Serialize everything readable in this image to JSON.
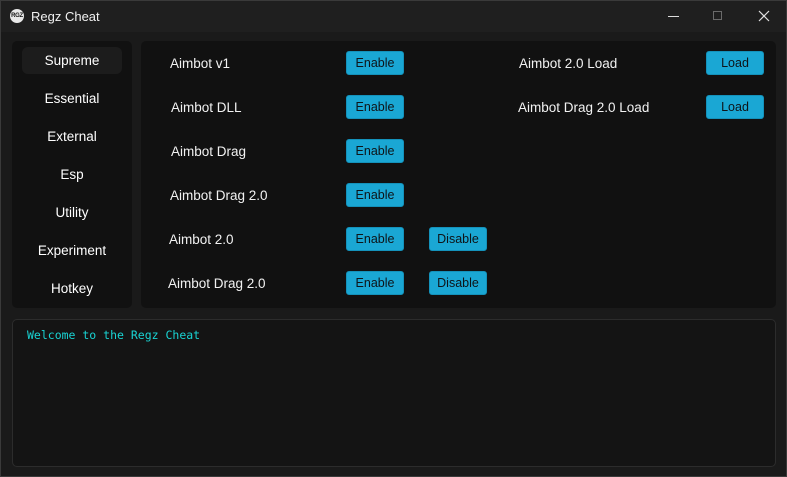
{
  "window": {
    "title": "Regz Cheat",
    "app_icon_text": "RGZ"
  },
  "sidebar": {
    "items": [
      {
        "label": "Supreme",
        "active": true
      },
      {
        "label": "Essential",
        "active": false
      },
      {
        "label": "External",
        "active": false
      },
      {
        "label": "Esp",
        "active": false
      },
      {
        "label": "Utility",
        "active": false
      },
      {
        "label": "Experiment",
        "active": false
      },
      {
        "label": "Hotkey",
        "active": false
      }
    ]
  },
  "main": {
    "rows": [
      {
        "label": "Aimbot v1",
        "enable": "Enable"
      },
      {
        "label": "Aimbot DLL",
        "enable": "Enable"
      },
      {
        "label": "Aimbot Drag",
        "enable": "Enable"
      },
      {
        "label": "Aimbot Drag 2.0",
        "enable": "Enable"
      },
      {
        "label": "Aimbot 2.0",
        "enable": "Enable",
        "disable": "Disable"
      },
      {
        "label": "Aimbot Drag 2.0",
        "enable": "Enable",
        "disable": "Disable"
      }
    ],
    "load_rows": [
      {
        "label": "Aimbot 2.0 Load",
        "button": "Load"
      },
      {
        "label": "Aimbot Drag 2.0 Load",
        "button": "Load"
      }
    ]
  },
  "console": {
    "text": "Welcome to the Regz Cheat"
  },
  "colors": {
    "accent": "#1aa7d4",
    "console_text": "#19d3d3",
    "background": "#1a1a1a",
    "panel": "#111111"
  }
}
